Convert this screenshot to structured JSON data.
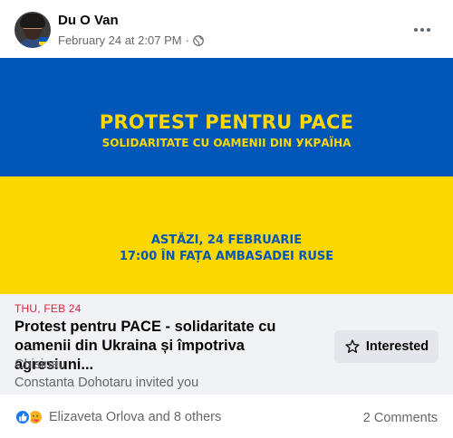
{
  "post": {
    "author": "Du O Van",
    "timestamp": "February 24 at 2:07 PM",
    "separator": "·",
    "privacy_icon": "globe-icon",
    "more_icon": "more-horizontal-icon"
  },
  "banner": {
    "title": "PROTEST PENTRU PACE",
    "subtitle": "SOLIDARITATE CU OAMENII DIN УКРАЇНА",
    "date_line": "ASTĂZI, 24 FEBRUARIE",
    "place_line": "17:00 ÎN FAȚA AMBASADEI RUSE",
    "colors": {
      "blue": "#0057b7",
      "yellow": "#fdd700"
    }
  },
  "event": {
    "date": "THU, FEB 24",
    "title": "Protest pentru PACE - solidaritate cu oamenii din Ukraina și împotriva agresiuni...",
    "location": "Chisinau",
    "invite": "Constanta Dohotaru invited you",
    "interested_label": "Interested",
    "interested_icon": "star-outline-icon",
    "date_color": "#e41e3f"
  },
  "footer": {
    "reaction_icons": [
      "like-reaction-icon",
      "care-reaction-icon"
    ],
    "reactors": "Elizaveta Orlova and 8 others",
    "comments": "2 Comments"
  }
}
